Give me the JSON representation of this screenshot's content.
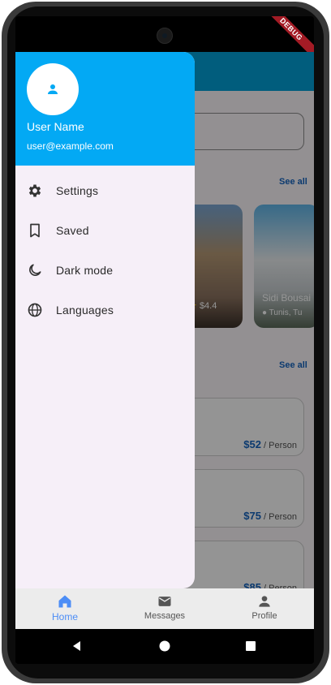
{
  "debug_banner": "DEBUG",
  "drawer": {
    "user_name": "User Name",
    "user_email": "user@example.com",
    "items": [
      {
        "label": "Settings",
        "icon": "gear-icon"
      },
      {
        "label": "Saved",
        "icon": "bookmark-icon"
      },
      {
        "label": "Dark mode",
        "icon": "moon-icon"
      },
      {
        "label": "Languages",
        "icon": "globe-icon"
      }
    ]
  },
  "background": {
    "see_all_1": "See all",
    "see_all_2": "See all",
    "cards": [
      {
        "rating": "$4.4"
      },
      {
        "title": "Sidi Bousai",
        "location": "Tunis, Tu"
      }
    ],
    "list": [
      {
        "price": "$52",
        "unit": "/ Person"
      },
      {
        "price": "$75",
        "unit": "/ Person"
      },
      {
        "price": "$85",
        "unit": "/ Person"
      }
    ]
  },
  "bottom_nav": {
    "items": [
      {
        "label": "Home",
        "icon": "home-icon",
        "active": true
      },
      {
        "label": "Messages",
        "icon": "mail-icon",
        "active": false
      },
      {
        "label": "Profile",
        "icon": "person-icon",
        "active": false
      }
    ]
  },
  "colors": {
    "drawer_header": "#03a9f4",
    "app_bar": "#02a0d8",
    "drawer_bg": "#f6eff8",
    "active_nav": "#4c8df6",
    "price_accent": "#1565c0"
  }
}
